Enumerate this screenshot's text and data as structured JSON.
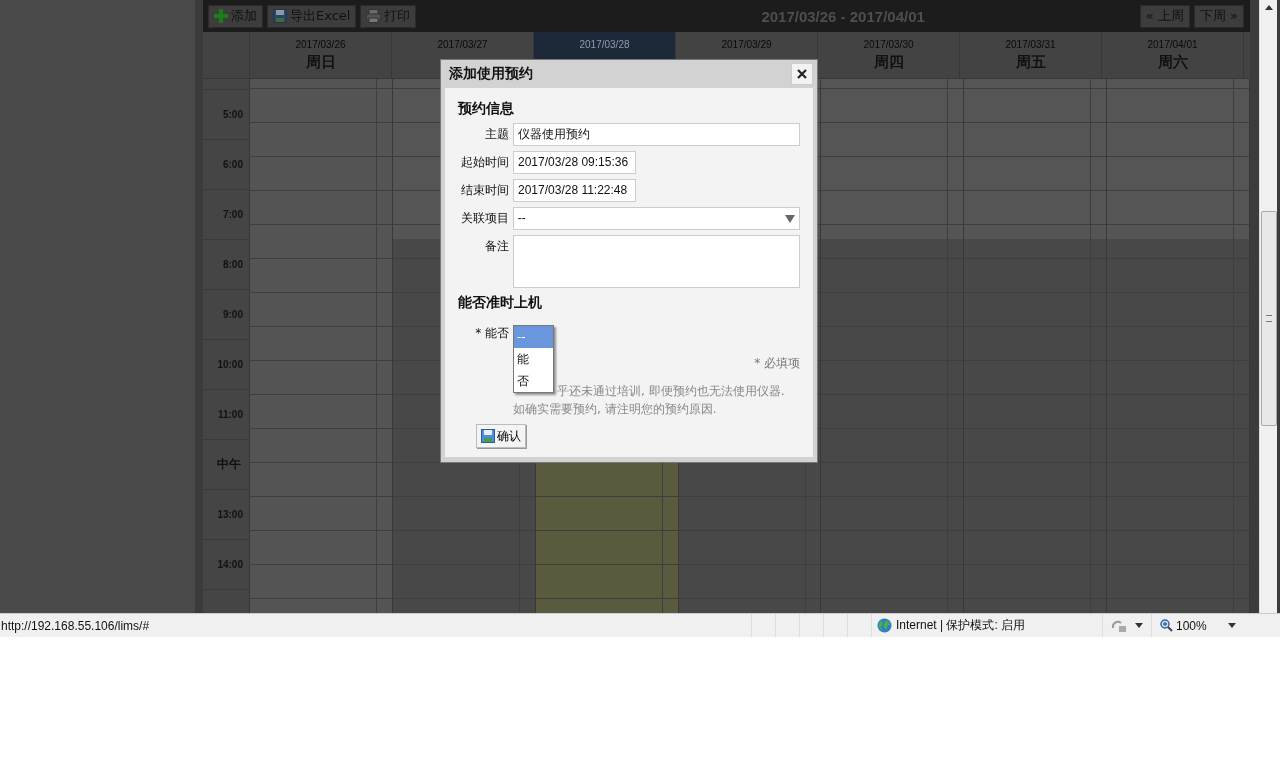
{
  "toolbar": {
    "buttons": [
      "添加",
      "导出Excel",
      "打印"
    ],
    "range": "2017/03/26 - 2017/04/01",
    "nav": [
      "« 上周",
      "下周 »"
    ]
  },
  "days": [
    {
      "date": "2017/03/26",
      "name": "周日",
      "selected": false
    },
    {
      "date": "2017/03/27",
      "selected": false
    },
    {
      "date": "2017/03/28",
      "selected": true
    },
    {
      "date": "2017/03/29",
      "selected": false
    },
    {
      "date": "2017/03/30",
      "name": "周四",
      "selected": false
    },
    {
      "date": "2017/03/31",
      "name": "周五",
      "selected": false
    },
    {
      "date": "2017/04/01",
      "name": "周六",
      "selected": false
    }
  ],
  "time_slots": [
    "5:00",
    "6:00",
    "7:00",
    "8:00",
    "9:00",
    "10:00",
    "11:00",
    "中午",
    "13:00",
    "14:00"
  ],
  "dialog": {
    "title": "添加使用预约",
    "section_1": "预约信息",
    "fields": [
      {
        "label": "主题",
        "kind": "text",
        "value": "仪器使用预约"
      },
      {
        "label": "起始时间",
        "kind": "short",
        "value": "2017/03/28 09:15:36"
      },
      {
        "label": "结束时间",
        "kind": "short",
        "value": "2017/03/28 11:22:48"
      },
      {
        "label": "关联项目",
        "kind": "select",
        "selection": "--"
      },
      {
        "label": "备注",
        "kind": "textarea"
      }
    ],
    "section_2": "能否准时上机",
    "required_label": "* 能否",
    "options": [
      {
        "label": "--",
        "selected": true
      },
      {
        "label": "能",
        "selected": false
      },
      {
        "label": "否",
        "selected": false
      }
    ],
    "required_note": "* 必填项",
    "notice": [
      "乎还未通过培训, 即便预约也无法使用仪器.",
      "如确实需要预约, 请注明您的预约原因."
    ],
    "confirm": "确认"
  },
  "status_bar": {
    "url": "http://192.168.55.106/lims/#",
    "zone": "Internet | 保护模式: 启用",
    "zoom": "100%"
  }
}
